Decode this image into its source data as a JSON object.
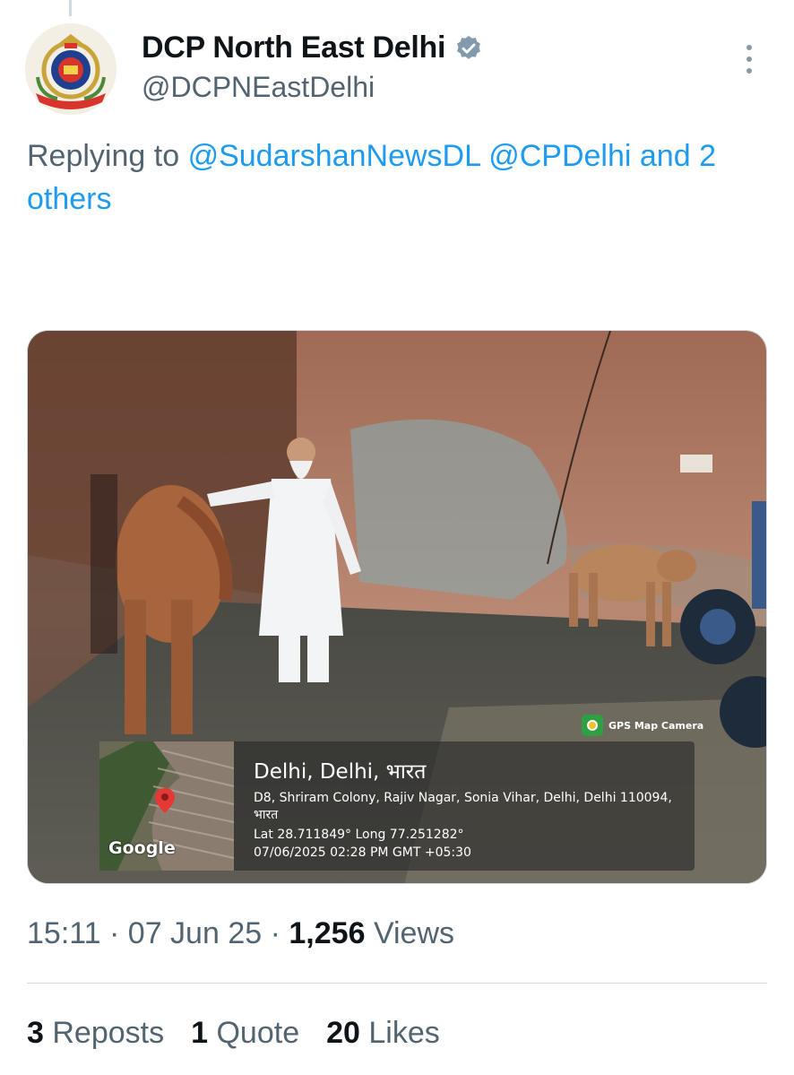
{
  "author": {
    "display_name": "DCP North East Delhi",
    "handle": "@DCPNEastDelhi",
    "verified_icon": "verified-badge-icon",
    "avatar": "delhi-police-emblem"
  },
  "reply": {
    "prefix": "Replying to",
    "mention1": "@SudarshanNewsDL",
    "mention2": "@CPDelhi",
    "rest": "and 2 others"
  },
  "media": {
    "description_icon": "photo",
    "gps_badge": "GPS Map Camera",
    "map_label": "Google",
    "location_title": "Delhi, Delhi, भारत",
    "address": "D8, Shriram Colony, Rajiv Nagar, Sonia Vihar, Delhi, Delhi 110094, भारत",
    "coordinates": "Lat 28.711849° Long 77.251282°",
    "datetime": "07/06/2025 02:28 PM GMT +05:30"
  },
  "meta": {
    "time": "15:11",
    "date": "07 Jun 25",
    "views_count": "1,256",
    "views_label": "Views"
  },
  "stats": {
    "reposts_count": "3",
    "reposts_label": "Reposts",
    "quotes_count": "1",
    "quotes_label": "Quote",
    "likes_count": "20",
    "likes_label": "Likes"
  },
  "colors": {
    "link": "#1d9bf0",
    "secondary_text": "#536471",
    "primary_text": "#0f1419",
    "verified": "#829aab"
  }
}
